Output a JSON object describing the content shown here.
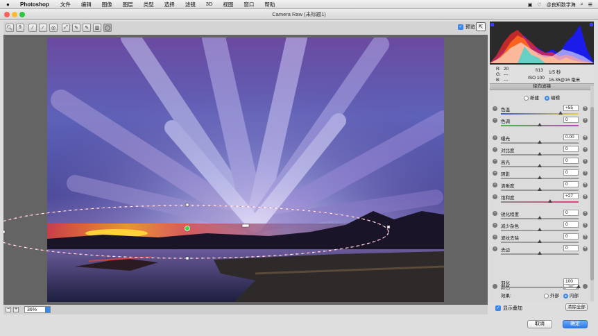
{
  "menubar": {
    "app_name": "Photoshop",
    "menus": [
      "文件",
      "编辑",
      "图像",
      "图层",
      "类型",
      "选择",
      "滤镜",
      "3D",
      "视图",
      "窗口",
      "帮助"
    ],
    "right_label": "@良知数学海"
  },
  "window": {
    "title": "Camera Raw (未标题1)"
  },
  "toolbar": {
    "preview_label": "预览"
  },
  "bottom": {
    "zoom": "36%",
    "show_overlay_label": "显示叠加",
    "clear_all_label": "清除全部",
    "cancel_label": "取消",
    "ok_label": "确定"
  },
  "info": {
    "r_label": "R:",
    "r_value": "20",
    "g_label": "G:",
    "g_value": "---",
    "b_label": "B:",
    "b_value": "---",
    "aperture": "f/13",
    "shutter": "1/5 秒",
    "iso": "ISO 100",
    "lens": "16-35@16 毫米"
  },
  "panel": {
    "title": "径向滤镜",
    "mode_new": "新建",
    "mode_edit": "编辑",
    "sliders": [
      {
        "label": "色温",
        "value": "+55",
        "pos": 0.77
      },
      {
        "label": "色调",
        "value": "0",
        "pos": 0.5
      },
      {
        "label": "曝光",
        "value": "0.00",
        "pos": 0.5
      },
      {
        "label": "对比度",
        "value": "0",
        "pos": 0.5
      },
      {
        "label": "高光",
        "value": "0",
        "pos": 0.5
      },
      {
        "label": "阴影",
        "value": "0",
        "pos": 0.5
      },
      {
        "label": "清晰度",
        "value": "0",
        "pos": 0.5
      },
      {
        "label": "饱和度",
        "value": "+27",
        "pos": 0.63
      },
      {
        "label": "锐化程度",
        "value": "0",
        "pos": 0.5
      },
      {
        "label": "减少杂色",
        "value": "0",
        "pos": 0.5
      },
      {
        "label": "波纹去除",
        "value": "0",
        "pos": 0.5
      },
      {
        "label": "去边",
        "value": "0",
        "pos": 0.5
      }
    ],
    "color_label": "颜色",
    "feather_label": "羽化",
    "feather_value": "100",
    "feather_pos": 1.0,
    "effect_label": "效果:",
    "effect_outside": "外部",
    "effect_inside": "内部"
  },
  "colors": {
    "accent": "#3c86ea",
    "mask_overlay": "#e03060"
  }
}
